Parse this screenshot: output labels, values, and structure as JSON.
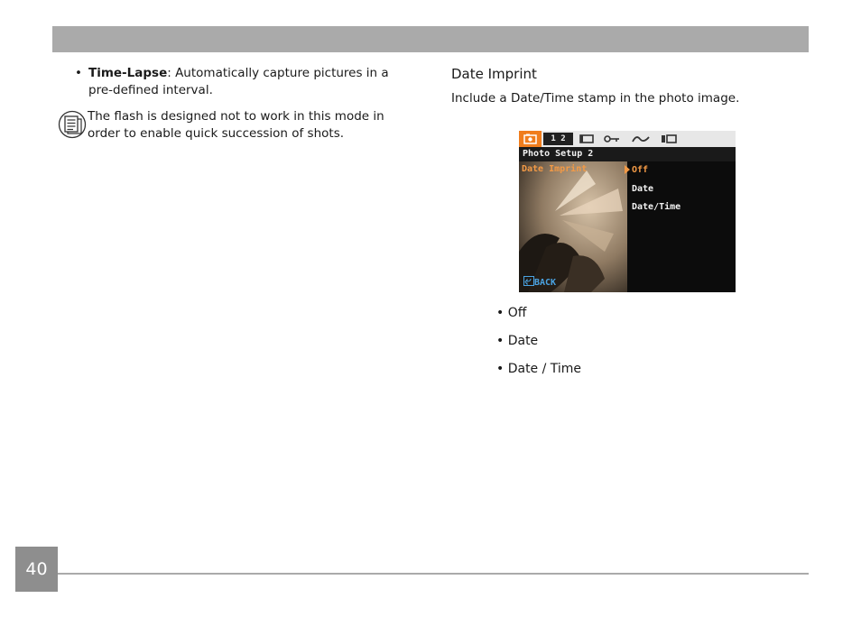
{
  "left": {
    "bullet": {
      "term": "Time-Lapse",
      "rest": ": Automatically capture pictures in a pre-defined interval."
    },
    "note": "The flash is designed not to work in this mode in order to enable quick succession of shots."
  },
  "right": {
    "heading": "Date Imprint",
    "description": "Include a Date/Time stamp in the photo image.",
    "screen": {
      "tab_number": "1 2",
      "title": "Photo Setup 2",
      "menu_label": "Date Imprint",
      "options": [
        "Off",
        "Date",
        "Date/Time"
      ],
      "back": "BACK",
      "accent_color": "#f07d1d"
    },
    "options": [
      "• Off",
      "• Date",
      "• Date / Time"
    ]
  },
  "footer": {
    "page_number": "40"
  }
}
